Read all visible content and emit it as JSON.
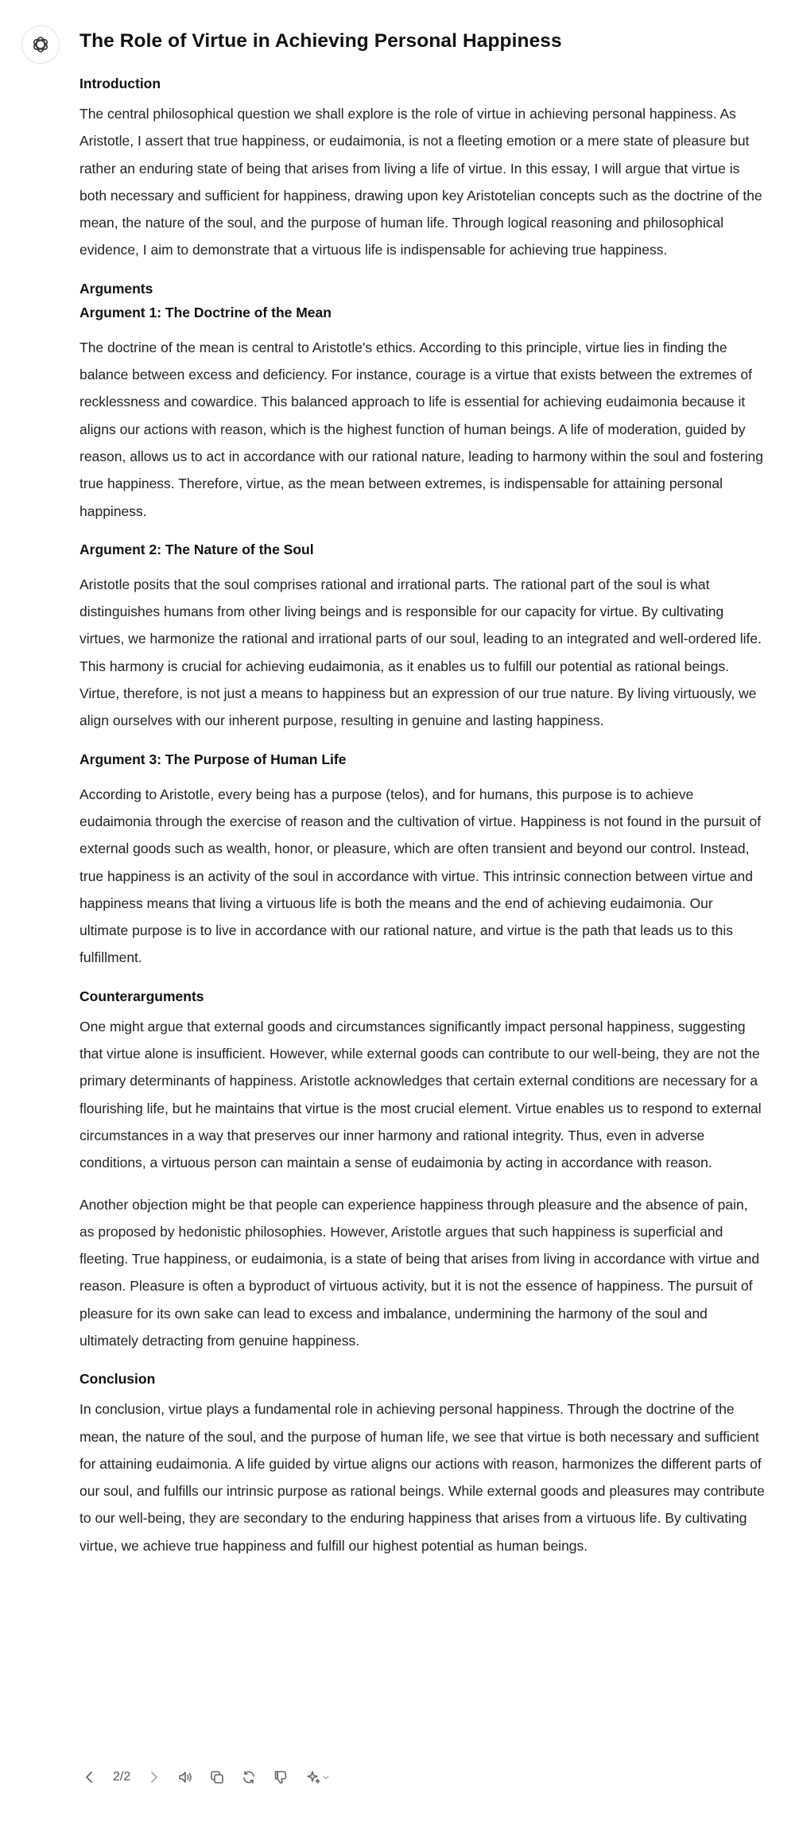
{
  "essay": {
    "title": "The Role of Virtue in Achieving Personal Happiness",
    "introduction": {
      "heading": "Introduction",
      "text": "The central philosophical question we shall explore is the role of virtue in achieving personal happiness. As Aristotle, I assert that true happiness, or eudaimonia, is not a fleeting emotion or a mere state of pleasure but rather an enduring state of being that arises from living a life of virtue. In this essay, I will argue that virtue is both necessary and sufficient for happiness, drawing upon key Aristotelian concepts such as the doctrine of the mean, the nature of the soul, and the purpose of human life. Through logical reasoning and philosophical evidence, I aim to demonstrate that a virtuous life is indispensable for achieving true happiness."
    },
    "arguments_heading": "Arguments",
    "arguments": [
      {
        "heading": "Argument 1: The Doctrine of the Mean",
        "text": "The doctrine of the mean is central to Aristotle's ethics. According to this principle, virtue lies in finding the balance between excess and deficiency. For instance, courage is a virtue that exists between the extremes of recklessness and cowardice. This balanced approach to life is essential for achieving eudaimonia because it aligns our actions with reason, which is the highest function of human beings. A life of moderation, guided by reason, allows us to act in accordance with our rational nature, leading to harmony within the soul and fostering true happiness. Therefore, virtue, as the mean between extremes, is indispensable for attaining personal happiness."
      },
      {
        "heading": "Argument 2: The Nature of the Soul",
        "text": "Aristotle posits that the soul comprises rational and irrational parts. The rational part of the soul is what distinguishes humans from other living beings and is responsible for our capacity for virtue. By cultivating virtues, we harmonize the rational and irrational parts of our soul, leading to an integrated and well-ordered life. This harmony is crucial for achieving eudaimonia, as it enables us to fulfill our potential as rational beings. Virtue, therefore, is not just a means to happiness but an expression of our true nature. By living virtuously, we align ourselves with our inherent purpose, resulting in genuine and lasting happiness."
      },
      {
        "heading": "Argument 3: The Purpose of Human Life",
        "text": "According to Aristotle, every being has a purpose (telos), and for humans, this purpose is to achieve eudaimonia through the exercise of reason and the cultivation of virtue. Happiness is not found in the pursuit of external goods such as wealth, honor, or pleasure, which are often transient and beyond our control. Instead, true happiness is an activity of the soul in accordance with virtue. This intrinsic connection between virtue and happiness means that living a virtuous life is both the means and the end of achieving eudaimonia. Our ultimate purpose is to live in accordance with our rational nature, and virtue is the path that leads us to this fulfillment."
      }
    ],
    "counterarguments": {
      "heading": "Counterarguments",
      "paragraphs": [
        "One might argue that external goods and circumstances significantly impact personal happiness, suggesting that virtue alone is insufficient. However, while external goods can contribute to our well-being, they are not the primary determinants of happiness. Aristotle acknowledges that certain external conditions are necessary for a flourishing life, but he maintains that virtue is the most crucial element. Virtue enables us to respond to external circumstances in a way that preserves our inner harmony and rational integrity. Thus, even in adverse conditions, a virtuous person can maintain a sense of eudaimonia by acting in accordance with reason.",
        "Another objection might be that people can experience happiness through pleasure and the absence of pain, as proposed by hedonistic philosophies. However, Aristotle argues that such happiness is superficial and fleeting. True happiness, or eudaimonia, is a state of being that arises from living in accordance with virtue and reason. Pleasure is often a byproduct of virtuous activity, but it is not the essence of happiness. The pursuit of pleasure for its own sake can lead to excess and imbalance, undermining the harmony of the soul and ultimately detracting from genuine happiness."
      ]
    },
    "conclusion": {
      "heading": "Conclusion",
      "text": "In conclusion, virtue plays a fundamental role in achieving personal happiness. Through the doctrine of the mean, the nature of the soul, and the purpose of human life, we see that virtue is both necessary and sufficient for attaining eudaimonia. A life guided by virtue aligns our actions with reason, harmonizes the different parts of our soul, and fulfills our intrinsic purpose as rational beings. While external goods and pleasures may contribute to our well-being, they are secondary to the enduring happiness that arises from a virtuous life. By cultivating virtue, we achieve true happiness and fulfill our highest potential as human beings."
    }
  },
  "toolbar": {
    "pager": "2/2",
    "icons": [
      "chevron-left-icon",
      "chevron-right-icon",
      "speaker-icon",
      "copy-icon",
      "regenerate-icon",
      "thumbs-down-icon",
      "sparkle-icon",
      "chevron-down-icon"
    ]
  },
  "colors": {
    "text": "#222222",
    "heading": "#111111",
    "icon": "#666666"
  }
}
